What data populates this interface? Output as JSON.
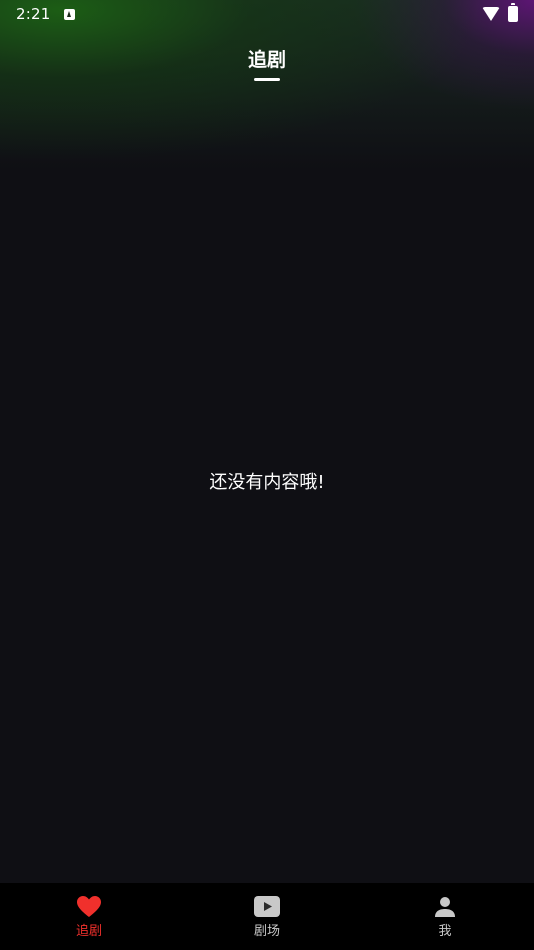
{
  "status_bar": {
    "time": "2:21"
  },
  "header": {
    "title": "追剧"
  },
  "empty_state": {
    "message": "还没有内容哦!"
  },
  "tab_bar": {
    "tabs": [
      {
        "label": "追剧",
        "icon": "heart-icon",
        "active": true
      },
      {
        "label": "剧场",
        "icon": "play-icon",
        "active": false
      },
      {
        "label": "我",
        "icon": "person-icon",
        "active": false
      }
    ]
  },
  "colors": {
    "background": "#0f0f14",
    "tab_bar_background": "#000000",
    "active_tab": "#f0302c",
    "inactive_tab": "#c8c8c8",
    "text": "#ffffff"
  }
}
